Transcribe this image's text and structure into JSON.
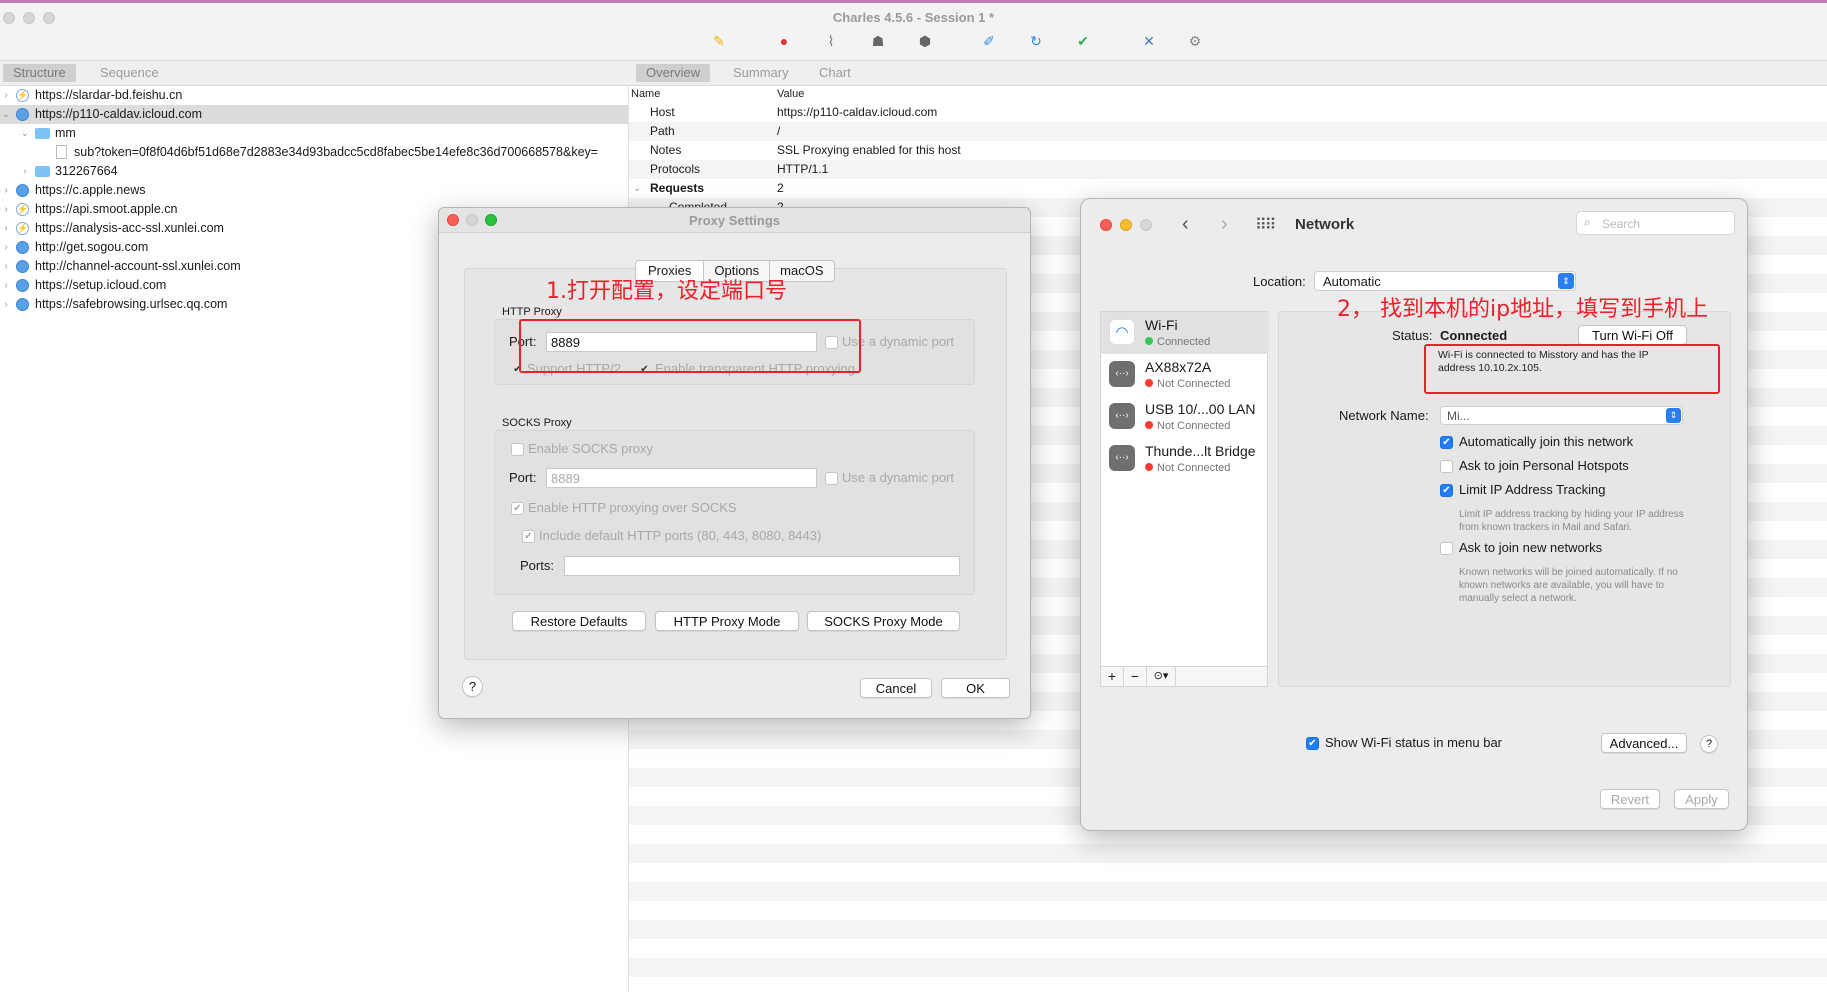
{
  "app": {
    "title": "Charles 4.5.6 - Session 1 *"
  },
  "toolbar": {
    "icons": [
      "broom-icon",
      "record-icon",
      "throttle-icon",
      "turtle-icon",
      "breakpoint-icon",
      "pen-icon",
      "refresh-icon",
      "check-icon",
      "tools-icon",
      "gear-icon"
    ]
  },
  "left_tabs": {
    "structure": "Structure",
    "sequence": "Sequence"
  },
  "right_tabs": {
    "overview": "Overview",
    "summary": "Summary",
    "chart": "Chart"
  },
  "tree": [
    {
      "label": "https://slardar-bd.feishu.cn",
      "icon": "bolt"
    },
    {
      "label": "https://p110-caldav.icloud.com",
      "icon": "globe"
    },
    {
      "label": "mm",
      "icon": "folder"
    },
    {
      "label": "sub?token=0f8f04d6bf51d68e7d2883e34d93badcc5cd8fabec5be14efe8c36d700668578&key=",
      "icon": "doc"
    },
    {
      "label": "312267664",
      "icon": "folder"
    },
    {
      "label": "https://c.apple.news",
      "icon": "globe"
    },
    {
      "label": "https://api.smoot.apple.cn",
      "icon": "bolt"
    },
    {
      "label": "https://analysis-acc-ssl.xunlei.com",
      "icon": "bolt"
    },
    {
      "label": "http://get.sogou.com",
      "icon": "globe"
    },
    {
      "label": "http://channel-account-ssl.xunlei.com",
      "icon": "globe"
    },
    {
      "label": "https://setup.icloud.com",
      "icon": "globe"
    },
    {
      "label": "https://safebrowsing.urlsec.qq.com",
      "icon": "globe"
    }
  ],
  "overview": {
    "col_name": "Name",
    "col_value": "Value",
    "rows": [
      {
        "name": "Host",
        "value": "https://p110-caldav.icloud.com"
      },
      {
        "name": "Path",
        "value": "/"
      },
      {
        "name": "Notes",
        "value": "SSL Proxying enabled for this host"
      },
      {
        "name": "Protocols",
        "value": "HTTP/1.1"
      },
      {
        "name": "Requests",
        "value": "2"
      },
      {
        "name": "Completed",
        "value": "2"
      }
    ]
  },
  "proxy_dialog": {
    "title": "Proxy Settings",
    "tabs": [
      "Proxies",
      "Options",
      "macOS"
    ],
    "http_proxy_label": "HTTP Proxy",
    "port_label": "Port:",
    "port_value": "8889",
    "dynamic_port": "Use a dynamic port",
    "support_http2": "Support HTTP/2",
    "transparent": "Enable transparent HTTP proxying",
    "socks_label": "SOCKS Proxy",
    "enable_socks": "Enable SOCKS proxy",
    "socks_port_value": "8889",
    "http_over_socks": "Enable HTTP proxying over SOCKS",
    "include_ports": "Include default HTTP ports (80, 443, 8080, 8443)",
    "ports_label": "Ports:",
    "restore": "Restore Defaults",
    "http_mode": "HTTP Proxy Mode",
    "socks_mode": "SOCKS Proxy Mode",
    "help": "?",
    "cancel": "Cancel",
    "ok": "OK"
  },
  "annotation1": "1.打开配置，设定端口号",
  "annotation2": "2， 找到本机的ip地址，填写到手机上",
  "network": {
    "title": "Network",
    "search_placeholder": "Search",
    "location_label": "Location:",
    "location_value": "Automatic",
    "services": [
      {
        "name": "Wi-Fi",
        "status": "Connected",
        "color": "#34c759",
        "icon": "wifi-icon"
      },
      {
        "name": "AX88x72A",
        "status": "Not Connected",
        "color": "#ff3b30",
        "icon": "ethernet-icon"
      },
      {
        "name": "USB 10/...00 LAN",
        "status": "Not Connected",
        "color": "#ff3b30",
        "icon": "ethernet-icon"
      },
      {
        "name": "Thunde...lt Bridge",
        "status": "Not Connected",
        "color": "#ff3b30",
        "icon": "ethernet-icon"
      }
    ],
    "status_label": "Status:",
    "status_value": "Connected",
    "turn_off": "Turn Wi-Fi Off",
    "status_desc": "Wi-Fi is connected to Misstory and has the IP address 10.10.2x.105.",
    "network_name_label": "Network Name:",
    "network_name_value": "Mi...",
    "auto_join": "Automatically join this network",
    "hotspots": "Ask to join Personal Hotspots",
    "limit_ip": "Limit IP Address Tracking",
    "limit_ip_desc": "Limit IP address tracking by hiding your IP address from known trackers in Mail and Safari.",
    "ask_new": "Ask to join new networks",
    "ask_new_desc": "Known networks will be joined automatically. If no known networks are available, you will have to manually select a network.",
    "show_status": "Show Wi-Fi status in menu bar",
    "advanced": "Advanced...",
    "help": "?",
    "revert": "Revert",
    "apply": "Apply",
    "add": "+",
    "remove": "−",
    "action": "⊙▾"
  }
}
